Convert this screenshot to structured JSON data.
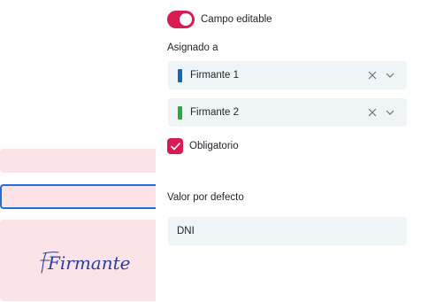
{
  "document": {
    "signature_field_label": "Firmante 1",
    "colors": {
      "field_background": "#fbe3e8",
      "focus_border": "#1f6fe0",
      "signature_ink": "#2a3f9a"
    }
  },
  "panel": {
    "editable_toggle": {
      "label": "Campo editable",
      "on": true
    },
    "assigned_to": {
      "label": "Asignado a",
      "signers": [
        {
          "name": "Firmante 1",
          "color": "#1565c0"
        },
        {
          "name": "Firmante 2",
          "color": "#2eaa3c"
        }
      ]
    },
    "required_checkbox": {
      "label": "Obligatorio",
      "checked": true
    },
    "default_value": {
      "label": "Valor por defecto",
      "value": "DNI"
    },
    "colors": {
      "accent": "#d81b52",
      "input_background": "#eff4f7"
    },
    "icons": {
      "clear": "close-icon",
      "expand": "chevron-down-icon",
      "check": "check-icon"
    }
  }
}
